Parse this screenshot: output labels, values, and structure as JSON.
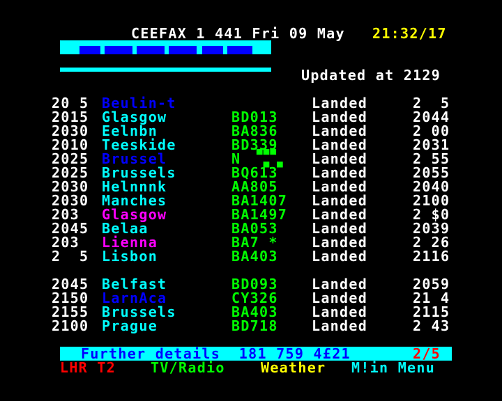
{
  "header": {
    "service": "CEEFAX",
    "line": "CEEFAX 1 441 Fri 09 May",
    "time": "21:32/17",
    "updated": "Updated at 2129"
  },
  "flights": [
    {
      "time": "20 5",
      "origin": "Beulin-t",
      "flight": "",
      "status": "Landed",
      "actual": "2  5",
      "color": "blue"
    },
    {
      "time": "2015",
      "origin": "Glasgow",
      "flight": "BD013",
      "status": "Landed",
      "actual": "2044",
      "color": "cyan"
    },
    {
      "time": "2030",
      "origin": "Eelnbn",
      "flight": "BA836",
      "status": "Landed",
      "actual": "2 00",
      "color": "cyan"
    },
    {
      "time": "2010",
      "origin": "Teeskide",
      "flight": "BD339",
      "status": "Landed",
      "actual": "2031",
      "color": "cyan"
    },
    {
      "time": "2025",
      "origin": "Brussel",
      "flight": "N",
      "status": "Landed",
      "actual": "2 55",
      "color": "blue"
    },
    {
      "time": "2025",
      "origin": "Brussels",
      "flight": "BQ613",
      "status": "Landed",
      "actual": "2055",
      "color": "cyan"
    },
    {
      "time": "2030",
      "origin": "Helnnnk",
      "flight": "AA805",
      "status": "Landed",
      "actual": "2040",
      "color": "cyan"
    },
    {
      "time": "2030",
      "origin": "Manches",
      "flight": "BA1407",
      "status": "Landed",
      "actual": "2100",
      "color": "cyan"
    },
    {
      "time": "203",
      "origin": "Glasgow",
      "flight": "BA1497",
      "status": "Landed",
      "actual": "2 $0",
      "color": "magenta"
    },
    {
      "time": "2045",
      "origin": "Belaa",
      "flight": "BA053",
      "status": "Landed",
      "actual": "2039",
      "color": "cyan"
    },
    {
      "time": "203",
      "origin": "Lienna",
      "flight": "BA7 *",
      "status": "Landed",
      "actual": "2 26",
      "color": "magenta"
    },
    {
      "time": "2  5",
      "origin": "Lisbon",
      "flight": "BA403",
      "status": "Landed",
      "actual": "2116",
      "color": "cyan"
    }
  ],
  "flights2": [
    {
      "time": "2045",
      "origin": "Belfast",
      "flight": "BD093",
      "status": "Landed",
      "actual": "2059",
      "color": "cyan"
    },
    {
      "time": "2150",
      "origin": "LarnAca",
      "flight": "CY326",
      "status": "Landed",
      "actual": "21 4",
      "color": "blue"
    },
    {
      "time": "2155",
      "origin": "Brussels",
      "flight": "BA403",
      "status": "Landed",
      "actual": "2115",
      "color": "cyan"
    },
    {
      "time": "2100",
      "origin": "Prague",
      "flight": "BD718",
      "status": "Landed",
      "actual": "2 43",
      "color": "cyan"
    }
  ],
  "footer": {
    "details": "Further details  181 759 4£21",
    "page": "2/5",
    "fastext": [
      "LHR T2",
      "TV/Radio",
      "Weather",
      "M!in Menu"
    ]
  }
}
